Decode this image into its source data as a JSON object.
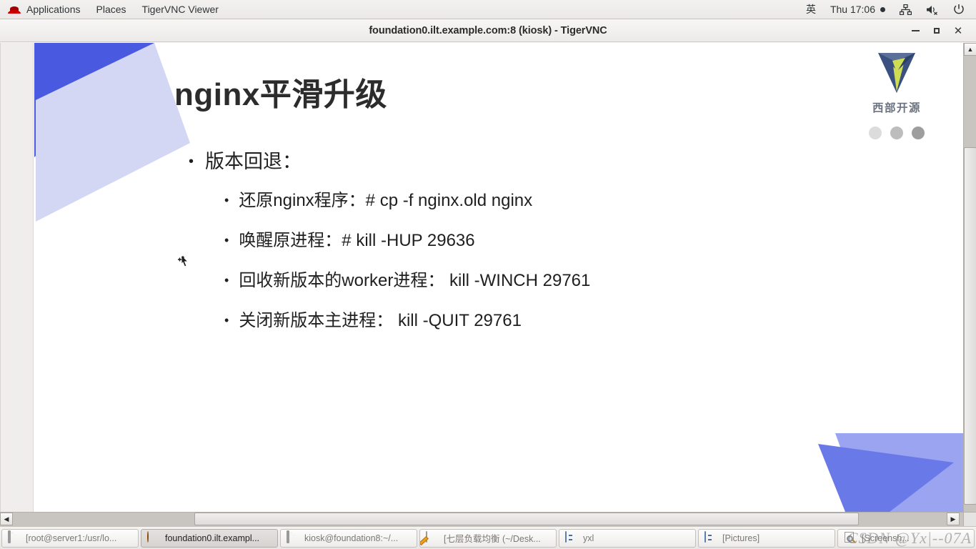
{
  "top_bar": {
    "left_items": [
      {
        "name": "applications",
        "label": "Applications"
      },
      {
        "name": "places",
        "label": "Places"
      },
      {
        "name": "tigervnc-viewer",
        "label": "TigerVNC Viewer"
      }
    ],
    "input_method": "英",
    "clock": "Thu 17:06",
    "icons": [
      "redhat-icon",
      "network-icon",
      "volume-muted-icon",
      "power-icon"
    ]
  },
  "window": {
    "title": "foundation0.ilt.example.com:8 (kiosk) - TigerVNC",
    "controls": {
      "minimize": "minimize",
      "maximize": "maximize",
      "close": "✕"
    }
  },
  "slide": {
    "title": "nginx平滑升级",
    "logo_text": "西部开源",
    "logo_dot_colors": [
      "#dcdcdc",
      "#bdbdbd",
      "#9e9e9e"
    ],
    "logo_colors": {
      "blue": "#3a5080",
      "navy": "#2d4166",
      "green": "#cfdd55"
    },
    "accent_colors": {
      "dark_blue": "#4a5ae0",
      "light_lavender": "#d3d7f4",
      "periwinkle": "#9aa4f0",
      "blue": "#6a79e8"
    },
    "bullets": [
      {
        "level": 1,
        "marker": "•",
        "text": "版本回退：",
        "children": [
          {
            "level": 2,
            "marker": "•",
            "text": "还原nginx程序：# cp -f nginx.old nginx"
          },
          {
            "level": 2,
            "marker": "•",
            "text": "唤醒原进程：# kill -HUP 29636"
          },
          {
            "level": 2,
            "marker": "•",
            "text": "回收新版本的worker进程： kill -WINCH 29761"
          },
          {
            "level": 2,
            "marker": "•",
            "text": "关闭新版本主进程： kill -QUIT 29761"
          }
        ]
      }
    ]
  },
  "scrollbars": {
    "vertical_up_arrow": "▲",
    "horizontal_left_arrow": "◀",
    "horizontal_right_arrow": "▶"
  },
  "taskbar": {
    "items": [
      {
        "icon": "terminal-icon",
        "label": "[root@server1:/usr/lo...",
        "active": false
      },
      {
        "icon": "tigervnc-icon",
        "label": "foundation0.ilt.exampl...",
        "active": true
      },
      {
        "icon": "terminal-icon",
        "label": "kiosk@foundation8:~/...",
        "active": false
      },
      {
        "icon": "text-editor-icon",
        "label": "[七层负载均衡 (~/Desk...",
        "active": false
      },
      {
        "icon": "file-manager-icon",
        "label": "yxl",
        "active": false
      },
      {
        "icon": "file-manager-icon",
        "label": "[Pictures]",
        "active": false
      },
      {
        "icon": "screenshot-icon",
        "label": "[Screensh...",
        "active": false
      }
    ]
  },
  "watermark": "CSDN @Yx|--07A"
}
